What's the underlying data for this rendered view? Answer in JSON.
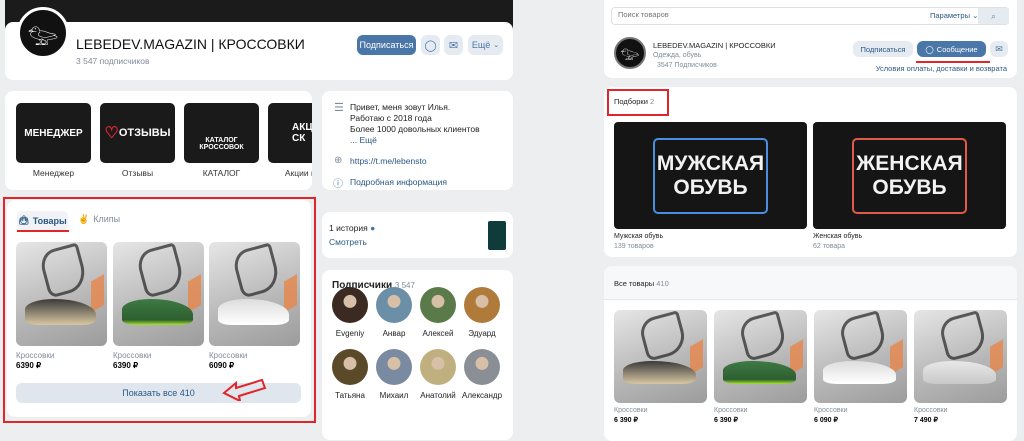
{
  "left": {
    "group_name": "LEBEDEV.MAGAZIN | КРОССОВКИ",
    "subscribers": "3 547 подписчиков",
    "subscribe_label": "Подписаться",
    "more_label": "Ещё",
    "covers": [
      {
        "image_text": "МЕНЕДЖЕР",
        "label": "Менеджер"
      },
      {
        "image_text": "ОТЗЫВЫ",
        "label": "Отзывы"
      },
      {
        "image_text": "КАТАЛОГ КРОССОВОК",
        "label": "КАТАЛОГ"
      },
      {
        "image_text": "АКЦИИ И СК",
        "label": "Акции и ск"
      }
    ],
    "info": {
      "description": [
        "Привет, меня зовут Илья.",
        "Работаю с 2018 года",
        "Более 1000 довольных клиентов"
      ],
      "more": "... Ещё",
      "link": "https://t.me/lebensto",
      "details": "Подробная информация"
    },
    "tabs": [
      {
        "label": "Товары"
      },
      {
        "label": "Клипы"
      }
    ],
    "products": [
      {
        "name": "Кроссовки",
        "price": "6390 ₽"
      },
      {
        "name": "Кроссовки",
        "price": "6390 ₽"
      },
      {
        "name": "Кроссовки",
        "price": "6090 ₽"
      }
    ],
    "show_all": "Показать все 410",
    "stories": {
      "count": "1 история",
      "view": "Смотреть"
    },
    "followers": {
      "title": "Подписчики",
      "count": "3 547",
      "people": [
        "Evgeniy",
        "Анвар",
        "Алексей",
        "Эдуард",
        "Татьяна",
        "Михаил",
        "Анатолий",
        "Александр"
      ]
    }
  },
  "right": {
    "search_placeholder": "Поиск товаров",
    "params_label": "Параметры",
    "group_name": "LEBEDEV.MAGAZIN | КРОССОВКИ",
    "category": "Одежда, обувь",
    "subscribers": "3547 Подписчиков",
    "subscribe_label": "Подписаться",
    "message_label": "Сообщение",
    "conditions": "Условия оплаты, доставки и возврата",
    "collections": {
      "title": "Подборки",
      "count": "2",
      "items": [
        {
          "image_text": "МУЖСКАЯ ОБУВЬ",
          "name": "Мужская обувь",
          "count": "139 товаров"
        },
        {
          "image_text": "ЖЕНСКАЯ ОБУВЬ",
          "name": "Женская обувь",
          "count": "62 товара"
        }
      ]
    },
    "all_goods": {
      "title": "Все товары",
      "count": "410",
      "products": [
        {
          "name": "Кроссовки",
          "price": "6 390 ₽"
        },
        {
          "name": "Кроссовки",
          "price": "6 390 ₽"
        },
        {
          "name": "Кроссовки",
          "price": "6 090 ₽"
        },
        {
          "name": "Кроссовки",
          "price": "7 490 ₽"
        }
      ]
    }
  },
  "colors": {
    "accent": "#4a76a8",
    "highlight": "#e0262b"
  }
}
